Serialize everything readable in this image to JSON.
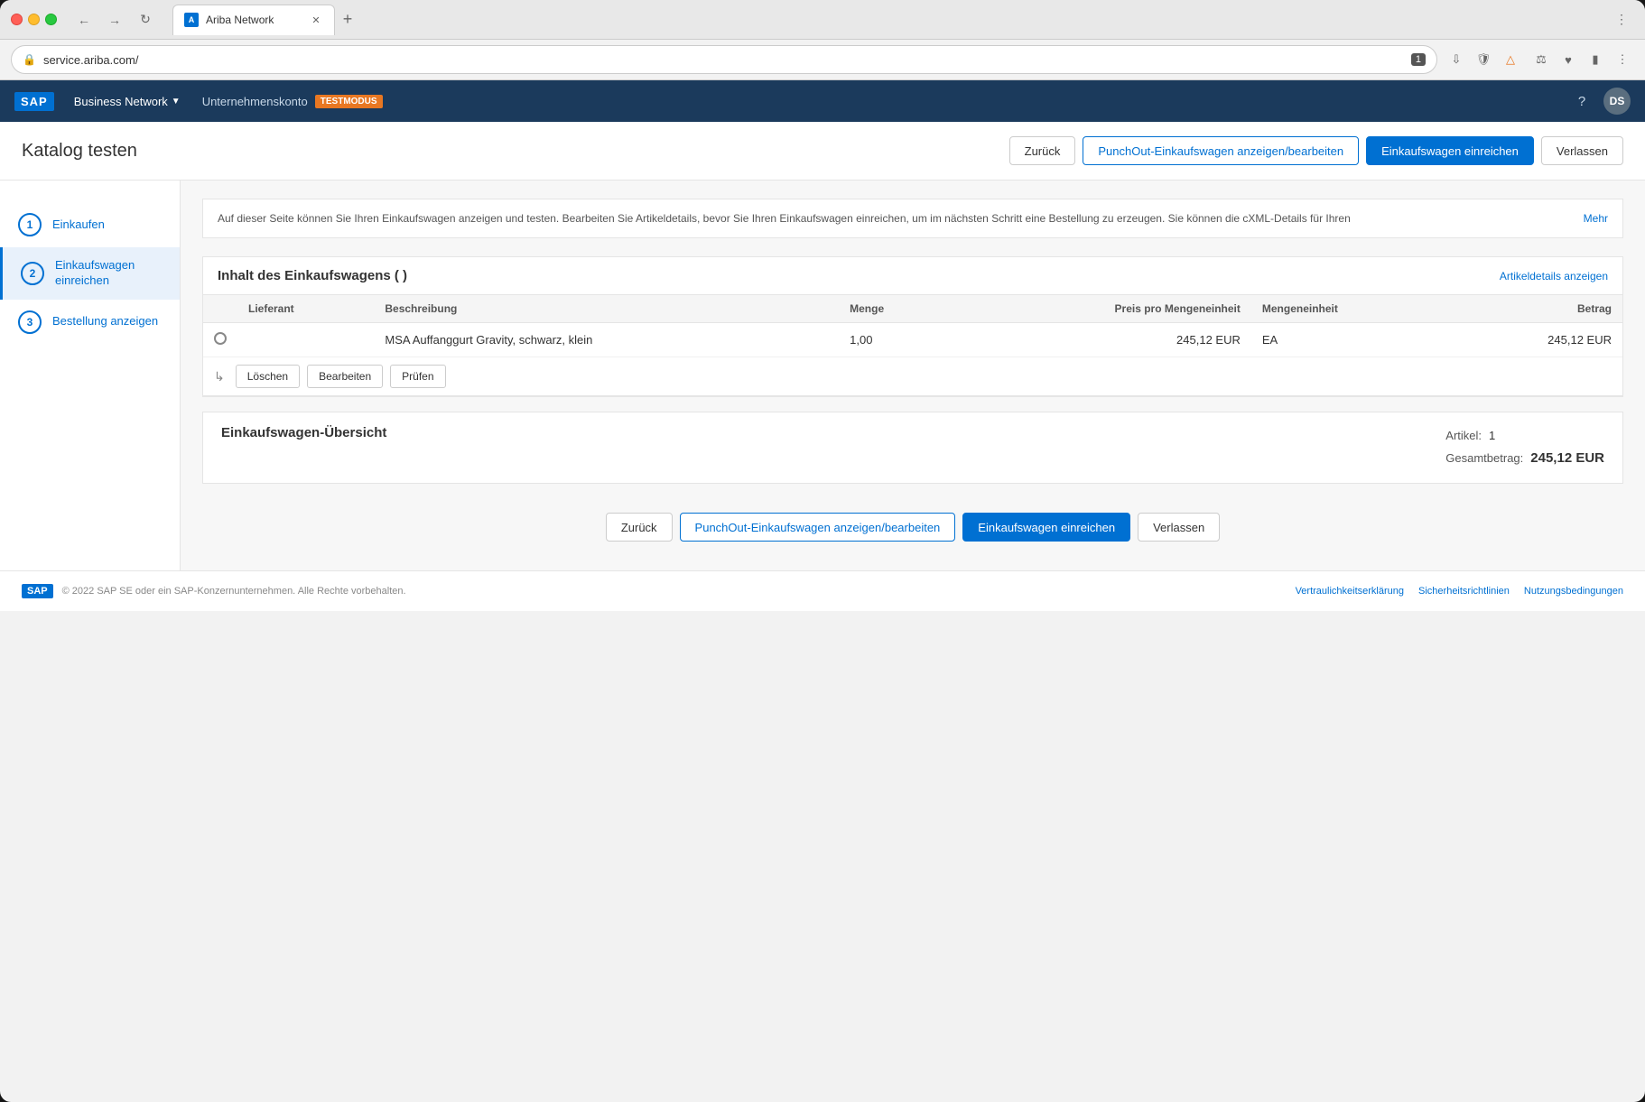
{
  "browser": {
    "tab_title": "Ariba Network",
    "tab_favicon_text": "A",
    "address": "service.ariba.com/",
    "badge": "1"
  },
  "header": {
    "logo": "SAP",
    "nav_items": [
      {
        "label": "Business Network",
        "active": true,
        "has_arrow": true
      },
      {
        "label": "Unternehmenskonto",
        "active": false
      },
      {
        "label": "TESTMODUS",
        "is_badge": true
      }
    ],
    "help_icon": "?",
    "avatar_initials": "DS"
  },
  "page": {
    "title": "Katalog testen",
    "back_button": "Zurück",
    "punchout_button": "PunchOut-Einkaufswagen anzeigen/bearbeiten",
    "submit_button": "Einkaufswagen einreichen",
    "leave_button": "Verlassen"
  },
  "steps": [
    {
      "number": "1",
      "label": "Einkaufen",
      "active": false
    },
    {
      "number": "2",
      "label": "Einkaufswagen einreichen",
      "active": true
    },
    {
      "number": "3",
      "label": "Bestellung anzeigen",
      "active": false
    }
  ],
  "info_banner": {
    "text": "Auf dieser Seite können Sie Ihren Einkaufswagen anzeigen und testen. Bearbeiten Sie Artikeldetails, bevor Sie Ihren Einkaufswagen einreichen, um im nächsten Schritt eine Bestellung zu erzeugen. Sie können die cXML-Details für Ihren",
    "more_link": "Mehr"
  },
  "cart": {
    "title": "Inhalt des Einkaufswagens ( )",
    "details_link": "Artikeldetails anzeigen",
    "columns": [
      {
        "key": "lieferant",
        "label": "Lieferant"
      },
      {
        "key": "beschreibung",
        "label": "Beschreibung"
      },
      {
        "key": "menge",
        "label": "Menge"
      },
      {
        "key": "preis",
        "label": "Preis pro Mengeneinheit"
      },
      {
        "key": "mengeneinheit",
        "label": "Mengeneinheit"
      },
      {
        "key": "betrag",
        "label": "Betrag"
      }
    ],
    "items": [
      {
        "lieferant": "",
        "beschreibung": "MSA Auffanggurt Gravity, schwarz, klein",
        "menge": "1,00",
        "preis": "245,12 EUR",
        "mengeneinheit": "EA",
        "betrag": "245,12 EUR"
      }
    ],
    "action_buttons": [
      {
        "label": "Löschen"
      },
      {
        "label": "Bearbeiten"
      },
      {
        "label": "Prüfen"
      }
    ]
  },
  "summary": {
    "title": "Einkaufswagen-Übersicht",
    "artikel_label": "Artikel:",
    "artikel_value": "1",
    "gesamtbetrag_label": "Gesamtbetrag:",
    "gesamtbetrag_value": "245,12 EUR"
  },
  "footer": {
    "logo": "SAP",
    "copyright": "© 2022 SAP SE oder ein SAP-Konzernunternehmen. Alle Rechte vorbehalten.",
    "links": [
      {
        "label": "Vertraulichkeitserklärung"
      },
      {
        "label": "Sicherheitsrichtlinien"
      },
      {
        "label": "Nutzungsbedingungen"
      }
    ]
  }
}
